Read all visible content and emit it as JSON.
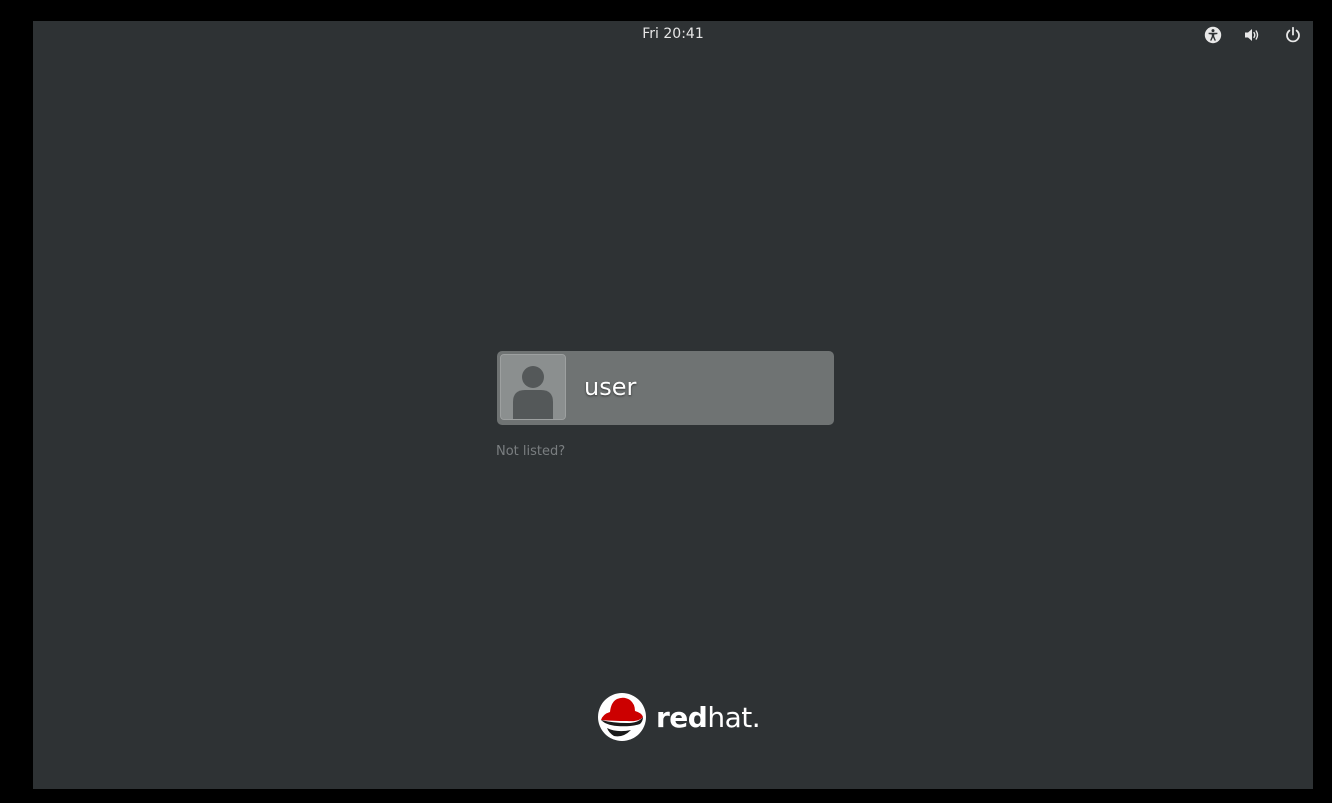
{
  "topbar": {
    "clock": "Fri 20:41",
    "icons": [
      "accessibility-icon",
      "volume-icon",
      "power-icon"
    ]
  },
  "login": {
    "users": [
      {
        "name": "user",
        "avatar": "default-user-avatar"
      }
    ],
    "not_listed": "Not listed?"
  },
  "branding": {
    "logo_part1": "red",
    "logo_part2": "hat",
    "trademark": "."
  },
  "colors": {
    "background": "#2e3234",
    "user_item": "#6f7373",
    "logo_red": "#cc0000"
  }
}
